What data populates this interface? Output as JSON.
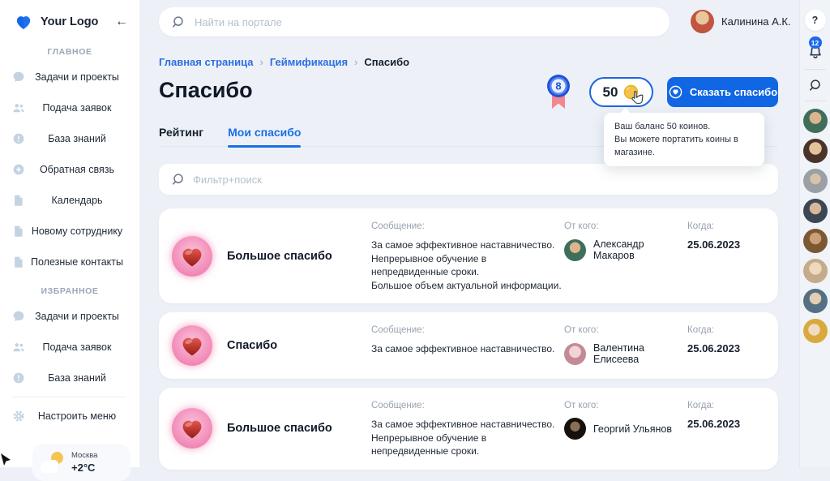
{
  "brand": {
    "logo_text": "Your Logo"
  },
  "icons": {
    "collapse": "←",
    "help": "?"
  },
  "sidebar": {
    "sections": [
      {
        "label": "ГЛАВНОЕ",
        "items": [
          {
            "label": "Задачи и проекты"
          },
          {
            "label": "Подача заявок"
          },
          {
            "label": "База знаний"
          },
          {
            "label": "Обратная связь"
          },
          {
            "label": "Календарь"
          },
          {
            "label": "Новому сотруднику"
          },
          {
            "label": "Полезные контакты"
          }
        ]
      },
      {
        "label": "ИЗБРАННОЕ",
        "items": [
          {
            "label": "Задачи и проекты"
          },
          {
            "label": "Подача заявок"
          },
          {
            "label": "База знаний"
          }
        ]
      }
    ],
    "menu_settings": "Настроить меню",
    "weather": {
      "city": "Москва",
      "temperature": "+2°C"
    }
  },
  "topbar": {
    "search_placeholder": "Найти на портале",
    "user_name": "Калинина А.К."
  },
  "right_rail": {
    "notifications_badge": "12"
  },
  "page": {
    "breadcrumb": {
      "items": [
        "Главная страница",
        "Геймификация",
        "Спасибо"
      ],
      "separator": "›"
    },
    "title": "Спасибо",
    "award_badge_value": "8",
    "coin_balance": "50",
    "say_thanks_button": "Сказать спасибо",
    "tooltip": {
      "line1": "Ваш баланс 50 коинов.",
      "line2": "Вы можете портатить коины в магазине."
    },
    "tabs": [
      {
        "label": "Рейтинг",
        "active": false
      },
      {
        "label": "Мои спасибо",
        "active": true
      }
    ],
    "filter_placeholder": "Фильтр+поиск",
    "card_labels": {
      "message": "Сообщение:",
      "from": "От кого:",
      "when": "Когда:"
    },
    "cards": [
      {
        "title": "Большое спасибо",
        "message_lines": [
          "За самое эффективное наставничество.",
          "Непрерывное обучение в непредвиденные сроки.",
          "Большое объем актуальной информации."
        ],
        "from": "Александр Макаров",
        "date": "25.06.2023"
      },
      {
        "title": "Спасибо",
        "message_lines": [
          "За самое эффективное наставничество."
        ],
        "from": "Валентина Елисеева",
        "date": "25.06.2023"
      },
      {
        "title": "Большое спасибо",
        "message_lines": [
          "За самое эффективное наставничество.",
          "Непрерывное обучение в непредвиденные сроки."
        ],
        "from": "Георгий Ульянов",
        "date": "25.06.2023"
      }
    ]
  },
  "colors": {
    "accent": "#1166e4",
    "breadcrumb_link": "#2d6fe0",
    "background": "#edf1f7",
    "ribbon_pink": "#f4868f",
    "coin_gold": "#f3c34a",
    "text_dark": "#1c2533",
    "text_muted": "#98a2b0"
  }
}
